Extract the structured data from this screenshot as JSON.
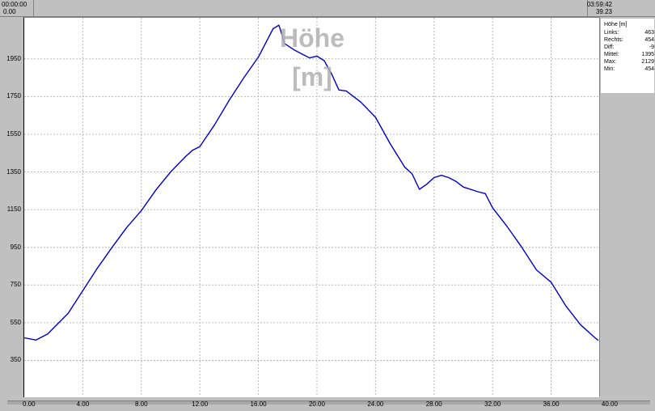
{
  "header": {
    "left_time": "00:00:00",
    "left_distance": "0.00",
    "right_time": "03:59:42",
    "right_distance": "39.23"
  },
  "stats": {
    "title": "Höhe [m]",
    "rows": [
      {
        "label": "Links:",
        "value": "463"
      },
      {
        "label": "Rechts:",
        "value": "454"
      },
      {
        "label": "Diff:",
        "value": "-9"
      },
      {
        "label": "Mittel:",
        "value": "1395"
      },
      {
        "label": "Max:",
        "value": "2129"
      },
      {
        "label": "Min:",
        "value": "454"
      }
    ]
  },
  "chart_data": {
    "type": "line",
    "title": "Höhe [m]",
    "xlabel": "",
    "ylabel": "",
    "xlim": [
      0,
      39.23
    ],
    "ylim": [
      163,
      2168
    ],
    "grid": true,
    "line_color": "#0000cc",
    "x_ticks": [
      "0.00",
      "4.00",
      "8.00",
      "12.00",
      "16.00",
      "20.00",
      "24.00",
      "28.00",
      "32.00",
      "36.00",
      "40.00"
    ],
    "y_ticks": [
      "350",
      "550",
      "750",
      "950",
      "1150",
      "1350",
      "1550",
      "1750",
      "1950"
    ],
    "series": [
      {
        "x": [
          0,
          0.8,
          1.6,
          3.0,
          4.0,
          5.0,
          6.0,
          7.0,
          8.0,
          9.0,
          10.0,
          11.0,
          11.5,
          12.0,
          13.0,
          14.0,
          15.0,
          16.0,
          17.0,
          17.4,
          17.8,
          18.5,
          19.0,
          19.5,
          20.0,
          20.5,
          21.0,
          21.5,
          22.0,
          23.0,
          24.0,
          25.0,
          26.0,
          26.5,
          27.0,
          27.5,
          28.0,
          28.5,
          29.0,
          29.5,
          30.0,
          31.0,
          31.5,
          32.0,
          33.0,
          34.0,
          35.0,
          36.0,
          37.0,
          38.0,
          39.0,
          39.23
        ],
        "values": [
          470,
          458,
          490,
          600,
          720,
          840,
          950,
          1055,
          1145,
          1255,
          1350,
          1430,
          1465,
          1485,
          1600,
          1730,
          1850,
          1960,
          2110,
          2129,
          2030,
          1995,
          1975,
          1955,
          1965,
          1940,
          1870,
          1785,
          1780,
          1720,
          1640,
          1500,
          1375,
          1340,
          1258,
          1285,
          1320,
          1332,
          1320,
          1300,
          1270,
          1245,
          1235,
          1160,
          1060,
          950,
          830,
          765,
          640,
          540,
          470,
          456
        ]
      }
    ]
  }
}
